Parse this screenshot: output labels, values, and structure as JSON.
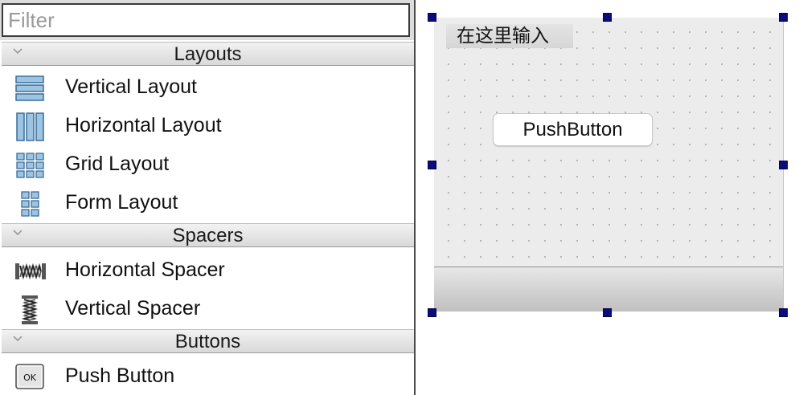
{
  "widget_box": {
    "filter_placeholder": "Filter",
    "categories": [
      {
        "title": "Layouts",
        "items": [
          {
            "label": "Vertical Layout",
            "icon": "vertical-layout-icon"
          },
          {
            "label": "Horizontal Layout",
            "icon": "horizontal-layout-icon"
          },
          {
            "label": "Grid Layout",
            "icon": "grid-layout-icon"
          },
          {
            "label": "Form Layout",
            "icon": "form-layout-icon"
          }
        ]
      },
      {
        "title": "Spacers",
        "items": [
          {
            "label": "Horizontal Spacer",
            "icon": "horizontal-spacer-icon"
          },
          {
            "label": "Vertical Spacer",
            "icon": "vertical-spacer-icon"
          }
        ]
      },
      {
        "title": "Buttons",
        "items": [
          {
            "label": "Push Button",
            "icon": "push-button-icon",
            "icon_text": "OK"
          }
        ]
      }
    ]
  },
  "form": {
    "menubar_placeholder": "在这里输入",
    "push_button_label": "PushButton"
  },
  "colors": {
    "selection_handle": "#0b0b7a",
    "form_background": "#ececec",
    "icon_blue": "#9cc4e4"
  }
}
